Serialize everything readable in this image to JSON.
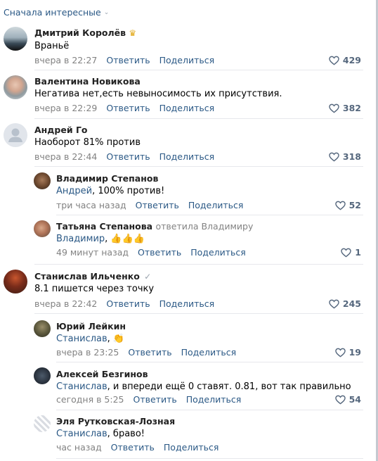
{
  "sort_label": "Сначала интересные",
  "comments": [
    {
      "name": "Дмитрий Королёв",
      "text": "Враньё",
      "time": "вчера в 22:27",
      "reply": "Ответить",
      "share": "Поделиться",
      "likes": "429"
    },
    {
      "name": "Валентина Новикова",
      "text": "Негатива нет,есть невыносимость их присутствия.",
      "time": "вчера в 22:29",
      "reply": "Ответить",
      "share": "Поделиться",
      "likes": "382"
    },
    {
      "name": "Андрей Го",
      "text": "Наоборот 81% против",
      "time": "вчера в 22:44",
      "reply": "Ответить",
      "share": "Поделиться",
      "likes": "318"
    },
    {
      "name": "Владимир Степанов",
      "mention": "Андрей",
      "text": ", 100% против!",
      "time": "три часа назад",
      "reply": "Ответить",
      "share": "Поделиться",
      "likes": "52"
    },
    {
      "name": "Татьяна Степанова",
      "replied": "ответила Владимиру",
      "mention": "Владимир",
      "text": ", 👍👍👍",
      "time": "49 минут назад",
      "reply": "Ответить",
      "share": "Поделиться",
      "likes": "1"
    },
    {
      "name": "Станислав Ильченко",
      "text": "8.1 пишется через точку",
      "time": "вчера в 22:42",
      "reply": "Ответить",
      "share": "Поделиться",
      "likes": "245"
    },
    {
      "name": "Юрий Лейкин",
      "mention": "Станислав",
      "text": ", 👏",
      "time": "вчера в 23:25",
      "reply": "Ответить",
      "share": "Поделиться",
      "likes": "19"
    },
    {
      "name": "Алексей Безгинов",
      "mention": "Станислав",
      "text": ", и впереди ещё 0 ставят. 0.81, вот так правильно",
      "time": "сегодня в 5:25",
      "reply": "Ответить",
      "share": "Поделиться",
      "likes": "54"
    },
    {
      "name": "Эля Рутковская-Лозная",
      "mention": "Станислав",
      "text": ", браво!",
      "time": "час назад",
      "reply": "Ответить",
      "share": "Поделиться"
    }
  ],
  "colors": {
    "link": "#2a5885",
    "meta": "#828282",
    "likes": "#55677d",
    "divider": "#e7e8ec"
  },
  "icons": {
    "like": "heart-outline-icon",
    "crown": "crown-icon",
    "verified": "checkmark-icon"
  }
}
